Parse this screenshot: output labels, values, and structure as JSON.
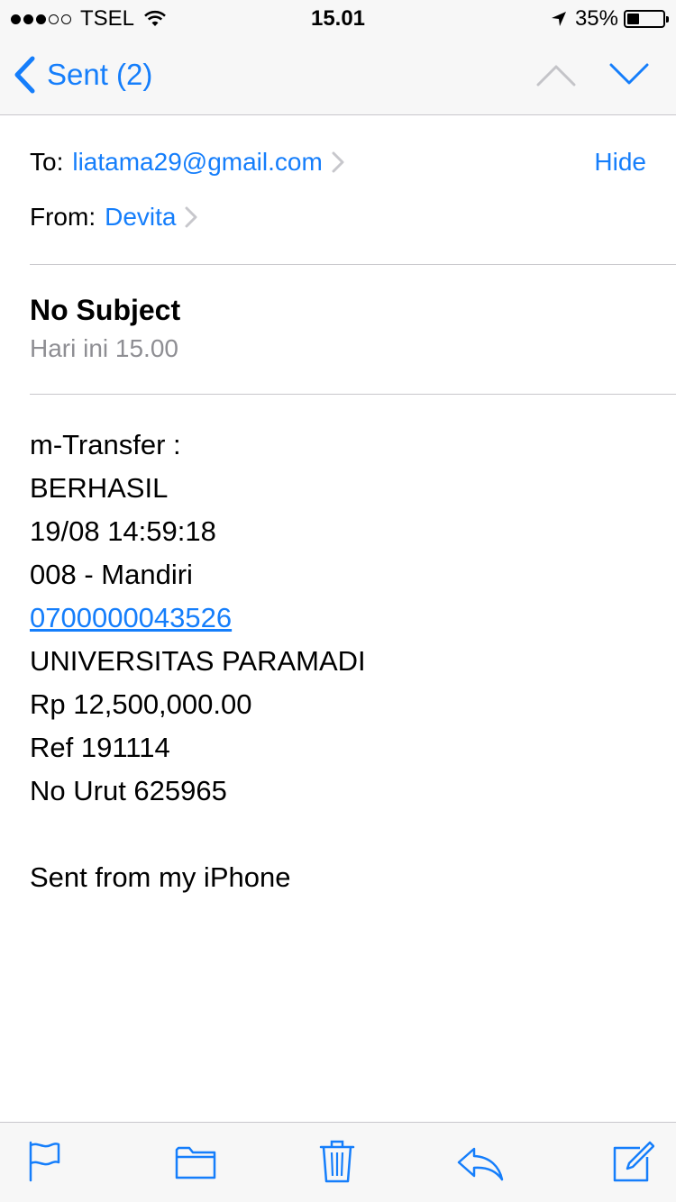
{
  "status_bar": {
    "carrier": "TSEL",
    "time": "15.01",
    "battery_percent": "35%",
    "battery_level": 0.35,
    "signal_bars_filled": 3,
    "signal_bars_total": 5
  },
  "nav": {
    "back_label": "Sent (2)",
    "icons": [
      "chevron-left-icon",
      "chevron-up-icon",
      "chevron-down-icon"
    ],
    "accent_color": "#157efb"
  },
  "header": {
    "to_label": "To:",
    "to_value": "liatama29@gmail.com",
    "hide_label": "Hide",
    "from_label": "From:",
    "from_value": "Devita"
  },
  "message": {
    "subject": "No Subject",
    "date": "Hari ini 15.00",
    "body_lines": [
      "m-Transfer :",
      "BERHASIL",
      "19/08 14:59:18",
      "008 - Mandiri",
      "0700000043526",
      "UNIVERSITAS PARAMADI",
      "Rp 12,500,000.00",
      "Ref 191114",
      "No Urut 625965"
    ],
    "signature": "Sent from my iPhone"
  },
  "toolbar": {
    "icons": [
      "flag-icon",
      "folder-icon",
      "trash-icon",
      "reply-icon",
      "compose-icon"
    ]
  }
}
